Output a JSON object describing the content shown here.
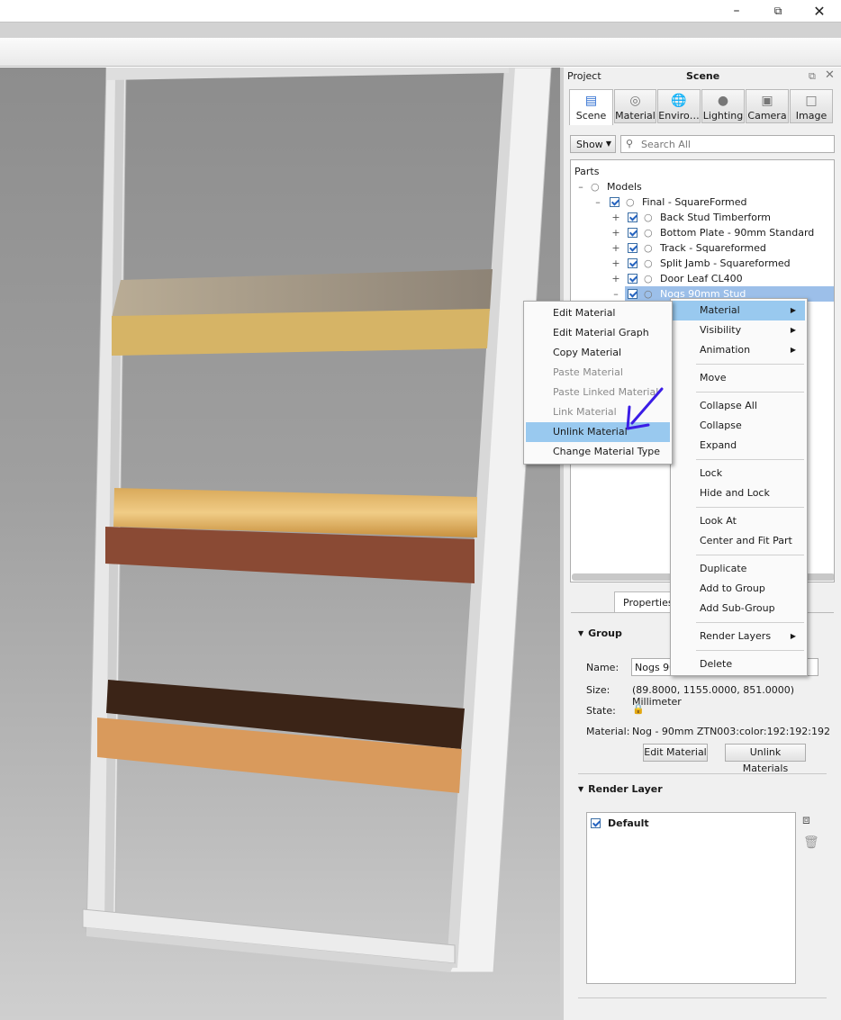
{
  "window": {
    "minimize_icon": "minimize-icon",
    "restore_icon": "restore-icon",
    "close_icon": "close-icon"
  },
  "panel": {
    "header_left": "Project",
    "header_title": "Scene",
    "tabs": [
      {
        "label": "Scene",
        "icon": "scene-icon"
      },
      {
        "label": "Material",
        "icon": "material-icon"
      },
      {
        "label": "Enviro…",
        "icon": "environment-icon"
      },
      {
        "label": "Lighting",
        "icon": "lighting-icon"
      },
      {
        "label": "Camera",
        "icon": "camera-icon"
      },
      {
        "label": "Image",
        "icon": "image-icon"
      }
    ],
    "show_label": "Show",
    "search_placeholder": "Search All",
    "tree": {
      "root": "Parts",
      "models": "Models",
      "group": "Final - SquareFormed",
      "items": [
        "Back Stud Timberform",
        "Bottom Plate - 90mm Standard",
        "Track - Squareformed",
        "Split Jamb - Squareformed",
        "Door Leaf CL400",
        "Nogs 90mm Stud"
      ]
    },
    "properties_tab": "Properties",
    "group_section": "Group",
    "name_label": "Name:",
    "name_value": "Nogs 90",
    "size_label": "Size:",
    "size_value": "(89.8000, 1155.0000, 851.0000) Millimeter",
    "state_label": "State:",
    "material_label": "Material:",
    "material_value": "Nog - 90mm ZTN003:color:192:192:192",
    "edit_material_btn": "Edit Material",
    "unlink_materials_btn": "Unlink Materials",
    "render_layer_section": "Render Layer",
    "render_layers": [
      "Default"
    ]
  },
  "context_menu": {
    "items": [
      "Material",
      "Visibility",
      "Animation",
      "Move",
      "Collapse All",
      "Collapse",
      "Expand",
      "Lock",
      "Hide and Lock",
      "Look At",
      "Center and Fit Part",
      "Duplicate",
      "Add to Group",
      "Add Sub-Group",
      "Render Layers",
      "Delete"
    ]
  },
  "submenu": {
    "items": [
      "Edit Material",
      "Edit Material Graph",
      "Copy Material",
      "Paste Material",
      "Paste Linked Material",
      "Link Material",
      "Unlink Material",
      "Change Material Type"
    ],
    "disabled": [
      "Paste Material",
      "Paste Linked Material",
      "Link Material"
    ],
    "highlighted": "Unlink Material"
  },
  "colors": {
    "highlight": "#99c9ef",
    "selection": "#9cbfe9",
    "annotation_arrow": "#3b1de6"
  }
}
